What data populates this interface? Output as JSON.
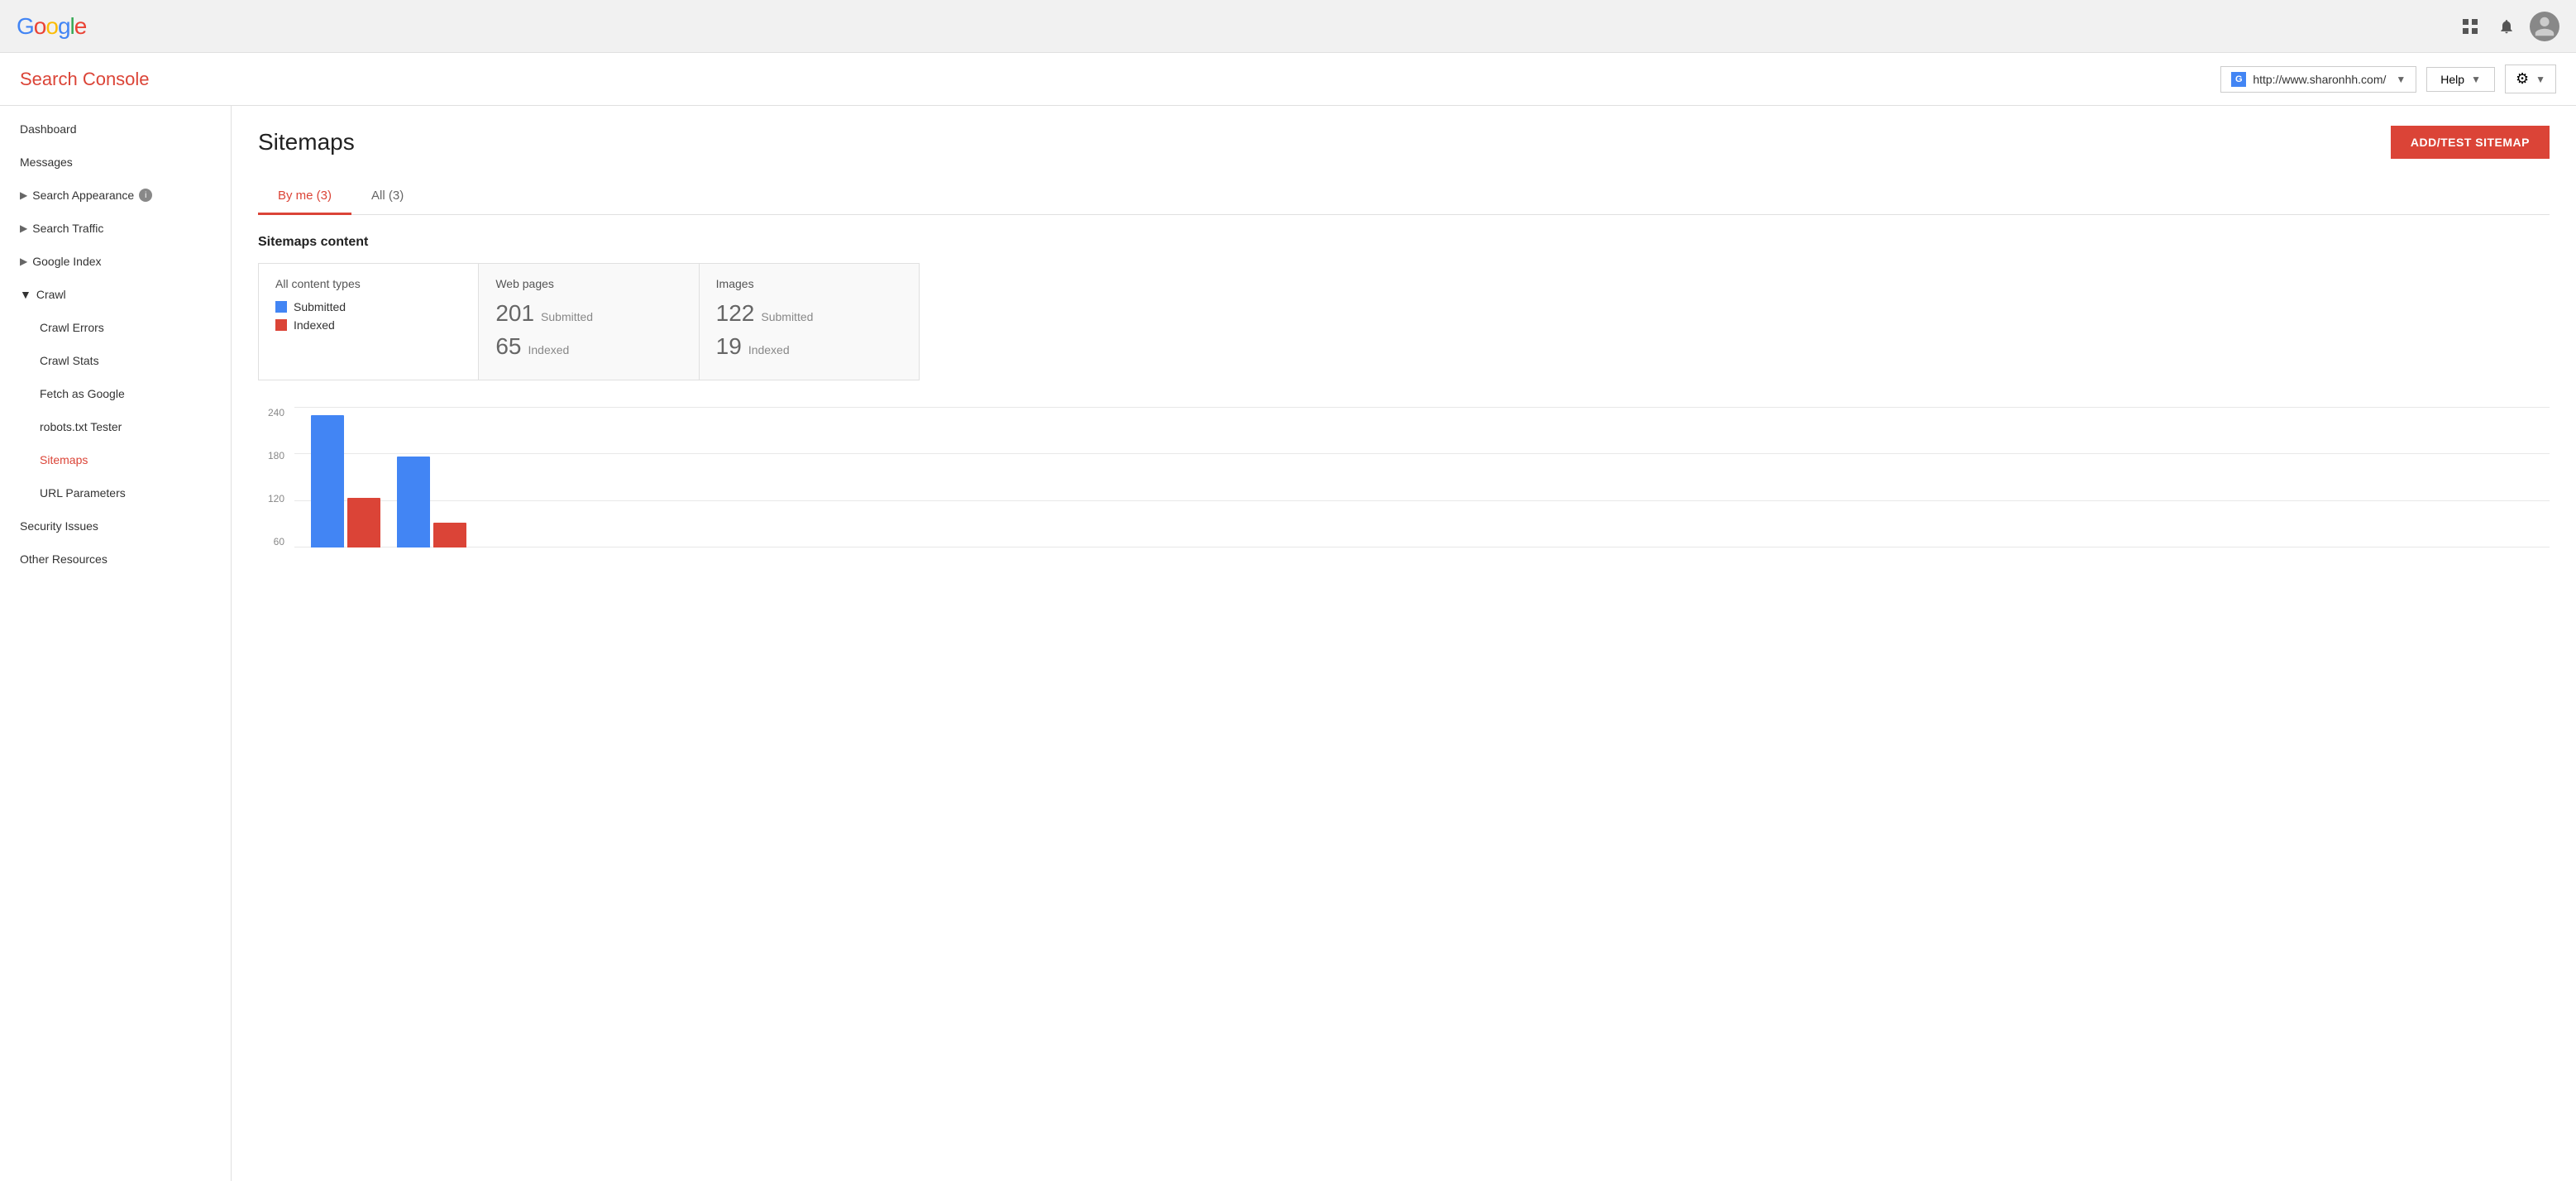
{
  "topbar": {
    "logo": "Google",
    "logo_letters": [
      "G",
      "o",
      "o",
      "g",
      "l",
      "e"
    ],
    "grid_icon": "⊞",
    "bell_icon": "🔔"
  },
  "subheader": {
    "title": "Search Console",
    "site_url": "http://www.sharonhh.com/",
    "help_label": "Help",
    "gear_icon": "⚙"
  },
  "sidebar": {
    "items": [
      {
        "label": "Dashboard",
        "indent": false,
        "active": false,
        "has_arrow": false
      },
      {
        "label": "Messages",
        "indent": false,
        "active": false,
        "has_arrow": false
      },
      {
        "label": "Search Appearance",
        "indent": false,
        "active": false,
        "has_arrow": true,
        "has_info": true
      },
      {
        "label": "Search Traffic",
        "indent": false,
        "active": false,
        "has_arrow": true
      },
      {
        "label": "Google Index",
        "indent": false,
        "active": false,
        "has_arrow": true
      },
      {
        "label": "Crawl",
        "indent": false,
        "active": false,
        "is_section": true,
        "expanded": true
      },
      {
        "label": "Crawl Errors",
        "indent": true,
        "active": false,
        "has_arrow": false
      },
      {
        "label": "Crawl Stats",
        "indent": true,
        "active": false,
        "has_arrow": false
      },
      {
        "label": "Fetch as Google",
        "indent": true,
        "active": false,
        "has_arrow": false
      },
      {
        "label": "robots.txt Tester",
        "indent": true,
        "active": false,
        "has_arrow": false
      },
      {
        "label": "Sitemaps",
        "indent": true,
        "active": true,
        "has_arrow": false
      },
      {
        "label": "URL Parameters",
        "indent": true,
        "active": false,
        "has_arrow": false
      },
      {
        "label": "Security Issues",
        "indent": false,
        "active": false,
        "has_arrow": false
      },
      {
        "label": "Other Resources",
        "indent": false,
        "active": false,
        "has_arrow": false
      }
    ]
  },
  "main": {
    "page_title": "Sitemaps",
    "add_button_label": "ADD/TEST SITEMAP",
    "tabs": [
      {
        "label": "By me (3)",
        "active": true
      },
      {
        "label": "All (3)",
        "active": false
      }
    ],
    "section_title": "Sitemaps content",
    "content_cols": [
      {
        "header": "All content types",
        "show_legend": true,
        "legend": [
          {
            "color": "#4285F4",
            "label": "Submitted"
          },
          {
            "color": "#DB4437",
            "label": "Indexed"
          }
        ],
        "stats": []
      },
      {
        "header": "Web pages",
        "show_legend": false,
        "stats": [
          {
            "number": "201",
            "label": "Submitted"
          },
          {
            "number": "65",
            "label": "Indexed"
          }
        ]
      },
      {
        "header": "Images",
        "show_legend": false,
        "stats": [
          {
            "number": "122",
            "label": "Submitted"
          },
          {
            "number": "19",
            "label": "Indexed"
          }
        ]
      }
    ],
    "chart": {
      "y_labels": [
        "240",
        "180",
        "120",
        "60"
      ],
      "bars": [
        {
          "blue_height": 160,
          "red_height": 60
        },
        {
          "blue_height": 110,
          "red_height": 30
        }
      ],
      "colors": {
        "blue": "#4285F4",
        "red": "#DB4437"
      }
    }
  }
}
